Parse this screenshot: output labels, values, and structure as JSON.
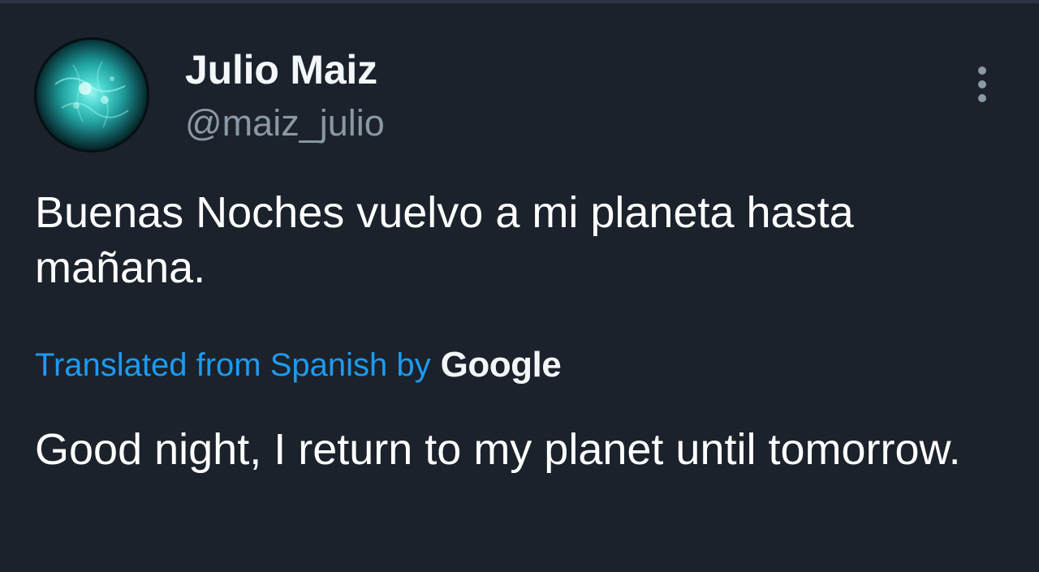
{
  "theme": {
    "background": "#1b222b",
    "text": "#ffffff",
    "secondary_text": "#8b98a5",
    "link": "#1d9bf0",
    "avatar_glow": "#1fd0c7"
  },
  "tweet": {
    "author": {
      "display_name": "Julio Maiz",
      "handle": "@maiz_julio",
      "avatar_icon": "teal-sun-avatar"
    },
    "more_icon": "vertical-ellipsis-icon",
    "original_text": "Buenas Noches vuelvo a mi planeta hasta mañana.",
    "translation": {
      "label": "Translated from Spanish by",
      "provider": "Google",
      "text": "Good night, I return to my planet until tomorrow."
    }
  }
}
